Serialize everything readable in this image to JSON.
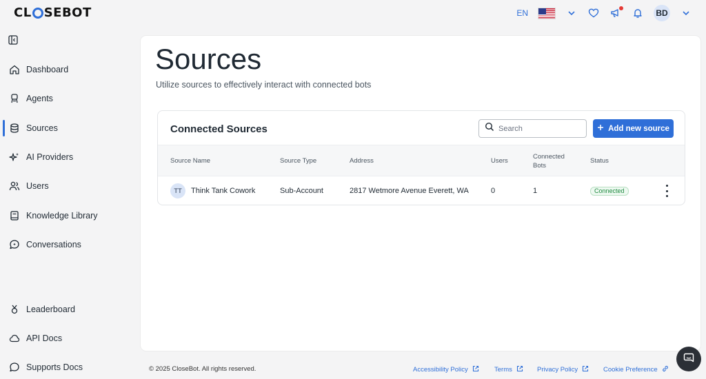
{
  "app": {
    "logo_text_a": "CL",
    "logo_text_b": "SEBOT"
  },
  "header": {
    "language": "EN",
    "user_initials": "BD"
  },
  "sidebar": {
    "items": [
      {
        "label": "Dashboard",
        "icon": "home-icon"
      },
      {
        "label": "Agents",
        "icon": "agent-icon"
      },
      {
        "label": "Sources",
        "icon": "database-icon"
      },
      {
        "label": "AI Providers",
        "icon": "sparkles-icon"
      },
      {
        "label": "Users",
        "icon": "users-icon"
      },
      {
        "label": "Knowledge Library",
        "icon": "book-icon"
      },
      {
        "label": "Conversations",
        "icon": "chat-icon"
      }
    ],
    "bottom_items": [
      {
        "label": "Leaderboard",
        "icon": "medal-icon"
      },
      {
        "label": "API Docs",
        "icon": "cloud-icon"
      },
      {
        "label": "Supports Docs",
        "icon": "chat-bubble-icon"
      }
    ],
    "active": "Sources"
  },
  "main": {
    "title": "Sources",
    "subtitle": "Utilize sources to effectively interact with connected bots",
    "panel": {
      "title": "Connected Sources",
      "search_placeholder": "Search",
      "add_label": "Add new source",
      "columns": {
        "name": "Source Name",
        "type": "Source Type",
        "address": "Address",
        "users": "Users",
        "bots_line1": "Connected",
        "bots_line2": "Bots",
        "status": "Status"
      },
      "rows": [
        {
          "initials": "TT",
          "name": "Think Tank Cowork",
          "type": "Sub-Account",
          "address": "2817 Wetmore Avenue Everett, WA",
          "users": "0",
          "bots": "1",
          "status": "Connected"
        }
      ]
    }
  },
  "footer": {
    "copyright": "© 2025 CloseBot. All rights reserved.",
    "links": [
      "Accessibility Policy",
      "Terms",
      "Privacy Policy",
      "Cookie Preference"
    ]
  },
  "colors": {
    "accent": "#2f6fd8",
    "status_green": "#1e8a3f"
  }
}
